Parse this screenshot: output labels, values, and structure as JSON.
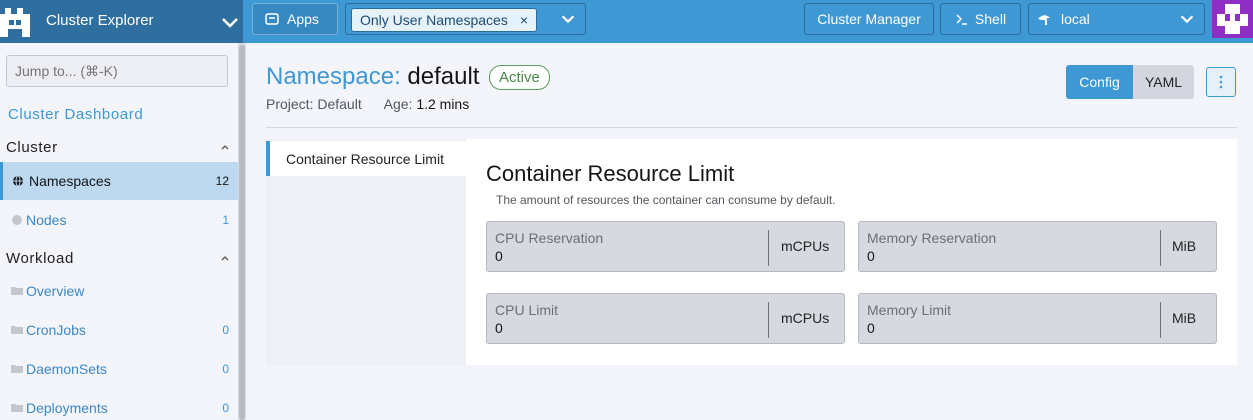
{
  "header": {
    "app_title": "Cluster Explorer",
    "apps_label": "Apps",
    "namespace_filter": "Only User Namespaces",
    "cluster_manager_label": "Cluster Manager",
    "shell_label": "Shell",
    "cluster_name": "local",
    "accent_color": "#3d98d3"
  },
  "sidebar": {
    "search_placeholder": "Jump to... (⌘-K)",
    "dashboard_link": "Cluster Dashboard",
    "groups": {
      "cluster": "Cluster",
      "workload": "Workload"
    },
    "items": [
      {
        "label": "Namespaces",
        "count": "12",
        "icon": "globe-icon"
      },
      {
        "label": "Nodes",
        "count": "1",
        "icon": "node-icon"
      },
      {
        "label": "Overview",
        "count": "",
        "icon": "folder-icon"
      },
      {
        "label": "CronJobs",
        "count": "0",
        "icon": "folder-icon"
      },
      {
        "label": "DaemonSets",
        "count": "0",
        "icon": "folder-icon"
      },
      {
        "label": "Deployments",
        "count": "0",
        "icon": "folder-icon"
      }
    ]
  },
  "page": {
    "title_prefix": "Namespace:",
    "title_name": "default",
    "status": "Active",
    "project_label": "Project:",
    "project_value": "Default",
    "age_label": "Age:",
    "age_value": "1.2 mins",
    "config_label": "Config",
    "yaml_label": "YAML",
    "status_color": "#4b8a4b"
  },
  "tabs": [
    {
      "label": "Container Resource Limit"
    }
  ],
  "section": {
    "title": "Container Resource Limit",
    "description": "The amount of resources the container can consume by default.",
    "fields": [
      {
        "label": "CPU Reservation",
        "value": "0",
        "unit": "mCPUs"
      },
      {
        "label": "Memory Reservation",
        "value": "0",
        "unit": "MiB"
      },
      {
        "label": "CPU Limit",
        "value": "0",
        "unit": "mCPUs"
      },
      {
        "label": "Memory Limit",
        "value": "0",
        "unit": "MiB"
      }
    ]
  }
}
